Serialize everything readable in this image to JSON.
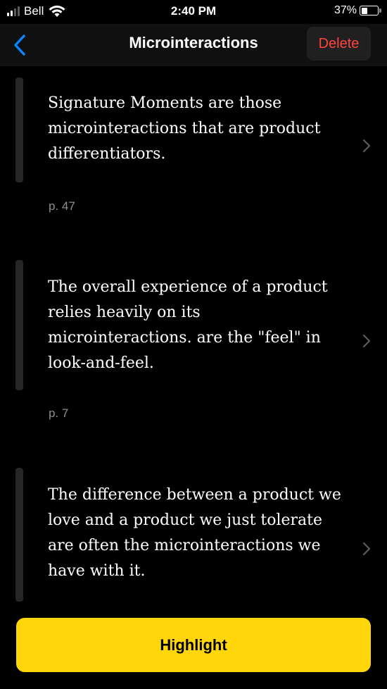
{
  "status_bar": {
    "carrier": "Bell",
    "time": "2:40 PM",
    "battery_percent": "37%",
    "battery_level": 0.37
  },
  "nav": {
    "title": "Microinteractions",
    "delete_label": "Delete",
    "back_icon": "chevron-left-icon"
  },
  "quotes": [
    {
      "text": "Signature Moments are those microinteractions that are product differentiators.",
      "page": "p. 47"
    },
    {
      "text": "The overall experience of a product relies heavily on its microinteractions. are the \"feel\" in look-and-feel.",
      "page": "p. 7"
    },
    {
      "text": "The difference between a product we love and a product we just tolerate are often the microinteractions we have with it.",
      "page": ""
    }
  ],
  "highlight_label": "Highlight",
  "colors": {
    "accent_blue": "#0a84ff",
    "delete_red": "#ff453a",
    "highlight_yellow": "#ffd60a"
  }
}
